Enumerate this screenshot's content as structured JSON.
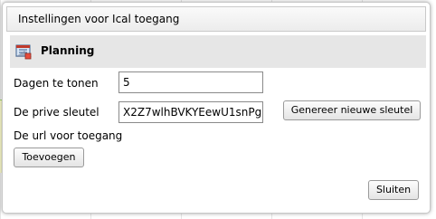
{
  "dialog": {
    "title": "Instellingen voor Ical toegang",
    "section_title": "Planning",
    "section_icon": "calendar-icon"
  },
  "fields": {
    "days_label": "Dagen te tonen",
    "days_value": "5",
    "key_label": "De prive sleutel",
    "key_value": "X2Z7wlhBVKYEewU1snPg",
    "url_label": "De url voor toegang"
  },
  "buttons": {
    "generate_key": "Genereer nieuwe sleutel",
    "add": "Toevoegen",
    "close": "Sluiten"
  }
}
